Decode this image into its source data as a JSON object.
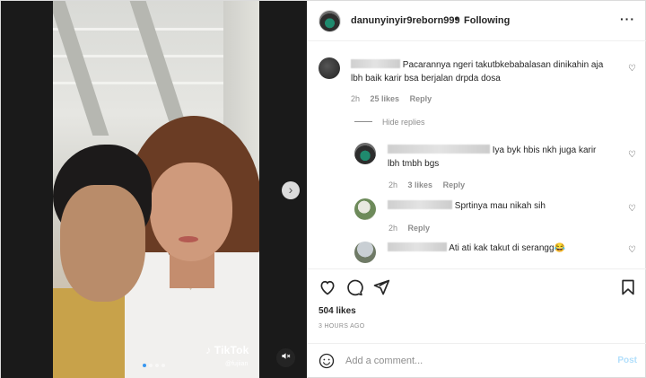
{
  "post": {
    "username": "danunyinyir9reborn999",
    "separator": "•",
    "follow_status": "Following",
    "more_icon": "more-horizontal-icon"
  },
  "media": {
    "watermark": "TikTok",
    "watermark_handle": "@fujiian",
    "carousel": {
      "total": 4,
      "active_index": 0
    },
    "next_icon": "chevron-right-icon",
    "mute_icon": "volume-muted-icon"
  },
  "comments": [
    {
      "text": "Pacarannya ngeri takutbkebabalasan dinikahin aja",
      "text2": "lbh baik karir bsa berjalan drpda dosa",
      "time": "2h",
      "likes": "25 likes",
      "reply": "Reply"
    }
  ],
  "hide_replies": "Hide replies",
  "replies": [
    {
      "text": "Iya byk hbis nkh juga karir",
      "text2": "lbh tmbh bgs",
      "time": "2h",
      "likes": "3 likes",
      "reply": "Reply"
    },
    {
      "text": "Sprtinya mau nikah sih",
      "time": "2h",
      "reply": "Reply"
    },
    {
      "text": "Ati ati kak takut di serangg😂"
    }
  ],
  "footer": {
    "likes_count": "504 likes",
    "time_ago": "3 HOURS AGO",
    "comment_placeholder": "Add a comment...",
    "post_label": "Post"
  },
  "colors": {
    "accent": "#3897f0",
    "post_disabled": "#b2dffc",
    "secondary_text": "#8e8e8e"
  }
}
